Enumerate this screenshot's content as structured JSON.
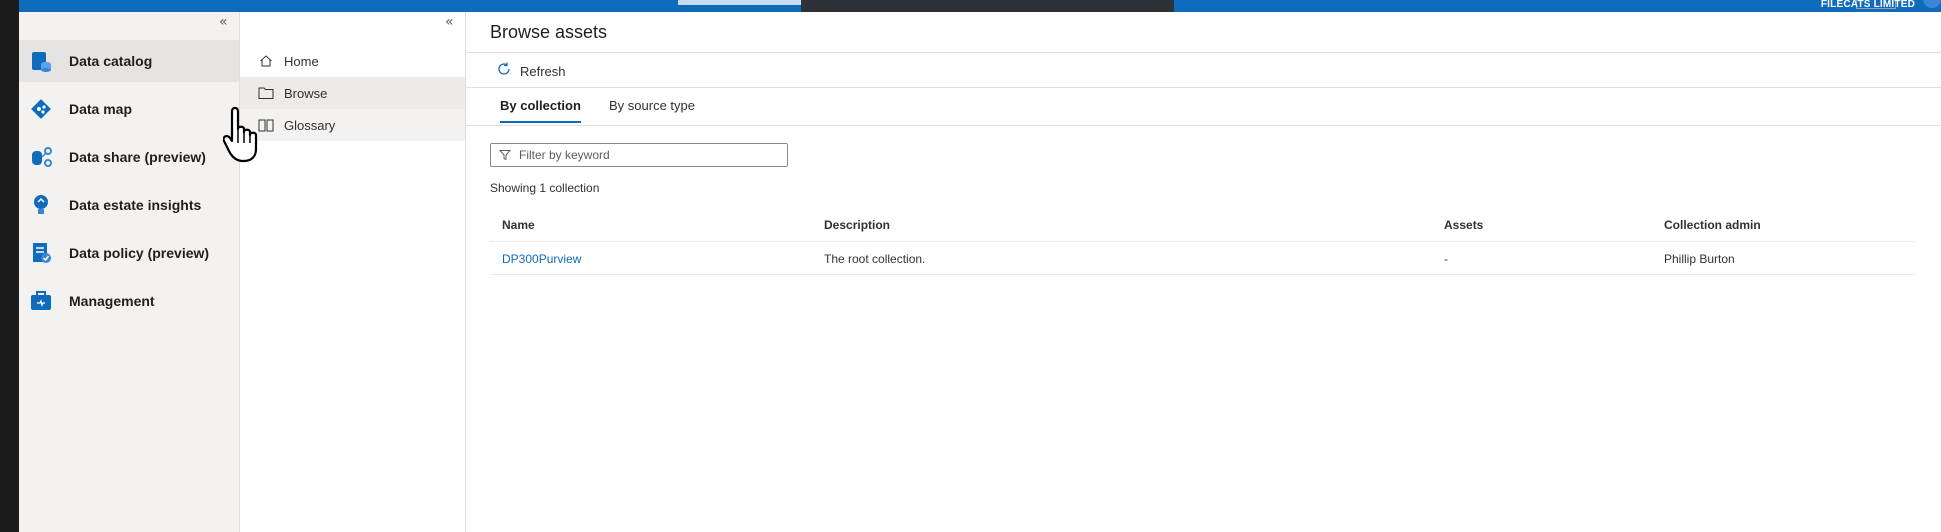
{
  "topbar": {
    "org_name": "FILECATS LIMITED"
  },
  "leftnav": {
    "items": [
      {
        "label": "Data catalog",
        "icon": "data-catalog-icon",
        "selected": true
      },
      {
        "label": "Data map",
        "icon": "data-map-icon",
        "selected": false
      },
      {
        "label": "Data share (preview)",
        "icon": "data-share-icon",
        "selected": false
      },
      {
        "label": "Data estate insights",
        "icon": "insights-icon",
        "selected": false
      },
      {
        "label": "Data policy (preview)",
        "icon": "data-policy-icon",
        "selected": false
      },
      {
        "label": "Management",
        "icon": "management-icon",
        "selected": false
      }
    ]
  },
  "subnav": {
    "items": [
      {
        "label": "Home",
        "icon": "home-icon"
      },
      {
        "label": "Browse",
        "icon": "folder-icon",
        "selected": true
      },
      {
        "label": "Glossary",
        "icon": "book-icon"
      }
    ]
  },
  "main": {
    "title": "Browse assets",
    "refresh_label": "Refresh",
    "tabs": [
      {
        "label": "By collection",
        "active": true
      },
      {
        "label": "By source type",
        "active": false
      }
    ],
    "filter_placeholder": "Filter by keyword",
    "showing_text": "Showing 1 collection",
    "table": {
      "headers": [
        "Name",
        "Description",
        "Assets",
        "Collection admin"
      ],
      "rows": [
        [
          "DP300Purview",
          "The root collection.",
          "-",
          "Phillip Burton"
        ]
      ]
    }
  },
  "colors": {
    "accent": "#0f6cbd",
    "nav_bg": "#f3f2f1",
    "selected_bg": "#e6e4e2"
  }
}
